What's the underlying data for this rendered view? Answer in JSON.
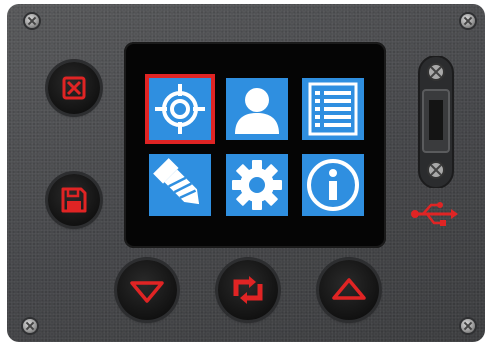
{
  "device": {
    "body_color": "#4a4b4d",
    "accent_color": "#e02424",
    "tile_color": "#2f8fe0"
  },
  "menu_tiles": [
    {
      "id": "target",
      "icon": "crosshair-target-icon",
      "selected": true
    },
    {
      "id": "user",
      "icon": "user-profile-icon",
      "selected": false
    },
    {
      "id": "list",
      "icon": "checklist-icon",
      "selected": false
    },
    {
      "id": "tool",
      "icon": "screw-drill-icon",
      "selected": false
    },
    {
      "id": "settings",
      "icon": "gear-icon",
      "selected": false
    },
    {
      "id": "info",
      "icon": "info-icon",
      "selected": false
    }
  ],
  "buttons": {
    "cancel": {
      "icon": "close-x-icon"
    },
    "save": {
      "icon": "floppy-disk-icon"
    },
    "down": {
      "icon": "triangle-down-icon"
    },
    "refresh": {
      "icon": "refresh-arrows-icon"
    },
    "up": {
      "icon": "triangle-up-icon"
    }
  },
  "port": {
    "icon": "usb-icon"
  }
}
